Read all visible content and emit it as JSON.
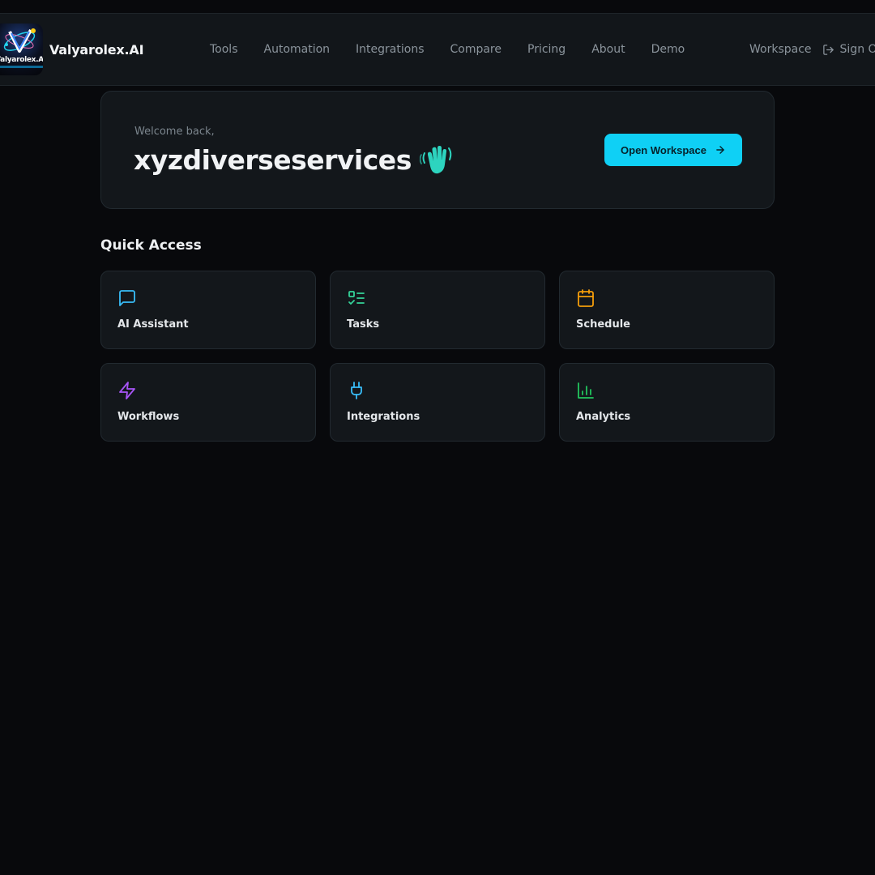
{
  "brand": {
    "logo_text": "Valyarolex.AI",
    "name": "Valyarolex.AI"
  },
  "nav": {
    "links": [
      "Tools",
      "Automation",
      "Integrations",
      "Compare",
      "Pricing",
      "About",
      "Demo"
    ],
    "workspace": "Workspace",
    "sign_out": "Sign Out"
  },
  "welcome": {
    "greeting": "Welcome back,",
    "username": "xyzdiverseservices",
    "cta": "Open Workspace"
  },
  "quick_access": {
    "title": "Quick Access",
    "tiles": [
      {
        "label": "AI Assistant",
        "icon": "chat-bubble-icon",
        "color": "#38bdf8"
      },
      {
        "label": "Tasks",
        "icon": "checklist-icon",
        "color": "#34d399"
      },
      {
        "label": "Schedule",
        "icon": "calendar-icon",
        "color": "#f59e0b"
      },
      {
        "label": "Workflows",
        "icon": "lightning-icon",
        "color": "#a855f7"
      },
      {
        "label": "Integrations",
        "icon": "plug-icon",
        "color": "#38bdf8"
      },
      {
        "label": "Analytics",
        "icon": "bar-chart-icon",
        "color": "#22c55e"
      }
    ]
  },
  "colors": {
    "accent": "#0fd0f5",
    "background": "#08090c",
    "card": "#13171b"
  }
}
